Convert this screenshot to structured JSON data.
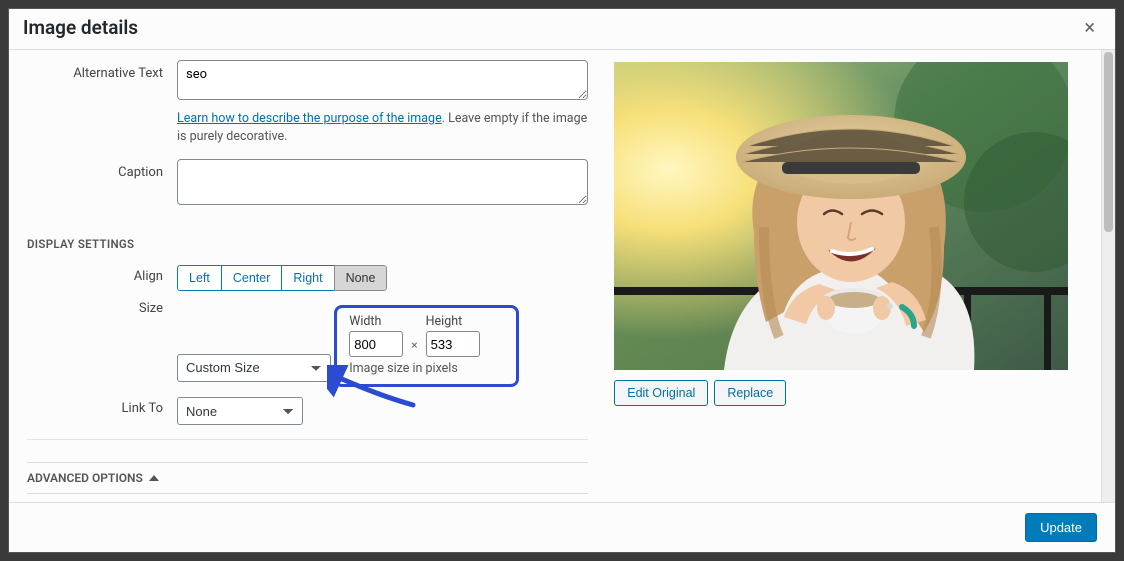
{
  "modal": {
    "title": "Image details",
    "close_glyph": "×"
  },
  "alt": {
    "label": "Alternative Text",
    "value": "seo",
    "hint_link": "Learn how to describe the purpose of the image",
    "hint_rest": ". Leave empty if the image is purely decorative."
  },
  "caption": {
    "label": "Caption",
    "value": ""
  },
  "display": {
    "heading": "DISPLAY SETTINGS",
    "align_label": "Align",
    "align_options": {
      "left": "Left",
      "center": "Center",
      "right": "Right",
      "none": "None"
    },
    "align_selected": "none",
    "size_label": "Size",
    "size_value": "Custom Size",
    "width_label": "Width",
    "width_value": "800",
    "height_label": "Height",
    "height_value": "533",
    "dim_mult": "×",
    "dim_hint": "Image size in pixels",
    "link_label": "Link To",
    "link_value": "None"
  },
  "advanced": {
    "label": "ADVANCED OPTIONS"
  },
  "preview": {
    "edit_label": "Edit Original",
    "replace_label": "Replace"
  },
  "footer": {
    "update_label": "Update"
  }
}
